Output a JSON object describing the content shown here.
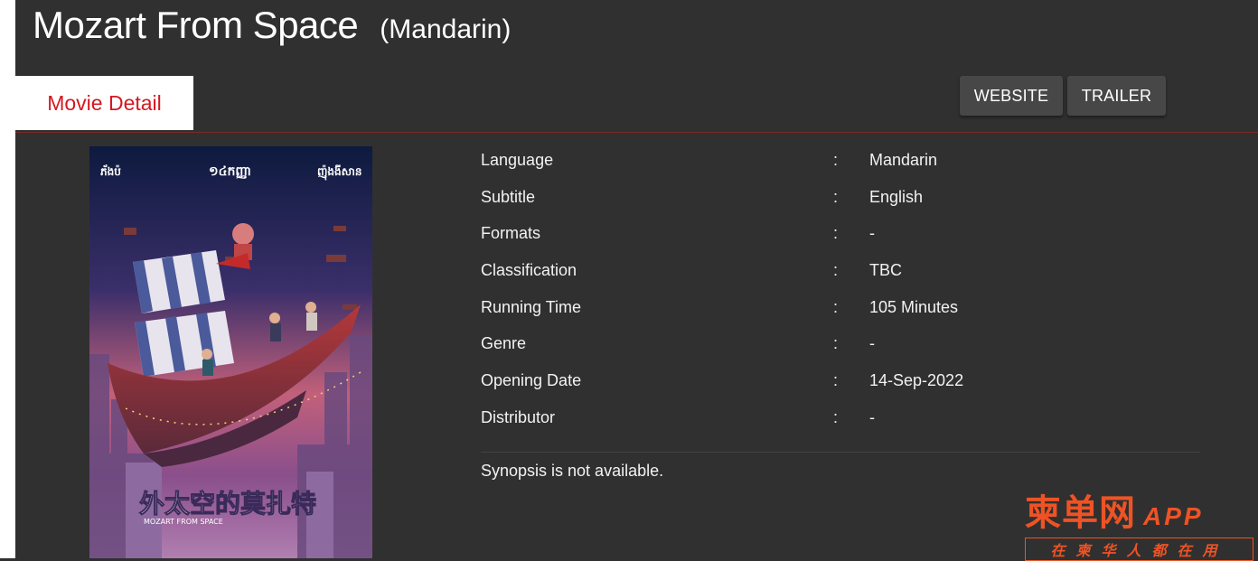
{
  "header": {
    "title": "Mozart From Space",
    "language_tag": "(Mandarin)"
  },
  "tabs": {
    "active": "Movie Detail"
  },
  "actions": {
    "website_label": "WEBSITE",
    "trailer_label": "TRAILER"
  },
  "poster": {
    "top_names": [
      "ភ័ងប៉",
      "១៤កញ្ញា",
      "ញ៉ុងងីសាន"
    ],
    "chinese_title": "外太空的莫扎特",
    "english_title": "MOZART FROM SPACE"
  },
  "details": {
    "separator": ":",
    "rows": [
      {
        "label": "Language",
        "value": "Mandarin"
      },
      {
        "label": "Subtitle",
        "value": "English"
      },
      {
        "label": "Formats",
        "value": "-"
      },
      {
        "label": "Classification",
        "value": "TBC"
      },
      {
        "label": "Running Time",
        "value": "105 Minutes"
      },
      {
        "label": "Genre",
        "value": "-"
      },
      {
        "label": "Opening Date",
        "value": "14-Sep-2022"
      },
      {
        "label": "Distributor",
        "value": "-"
      }
    ],
    "synopsis": "Synopsis is not available."
  },
  "watermark": {
    "brand_cn": "柬单网",
    "brand_app": "APP",
    "slogan": "在柬华人都在用"
  },
  "colors": {
    "background": "#303030",
    "tab_text": "#d4181f",
    "button_bg": "#474747",
    "watermark": "#ee5325"
  }
}
